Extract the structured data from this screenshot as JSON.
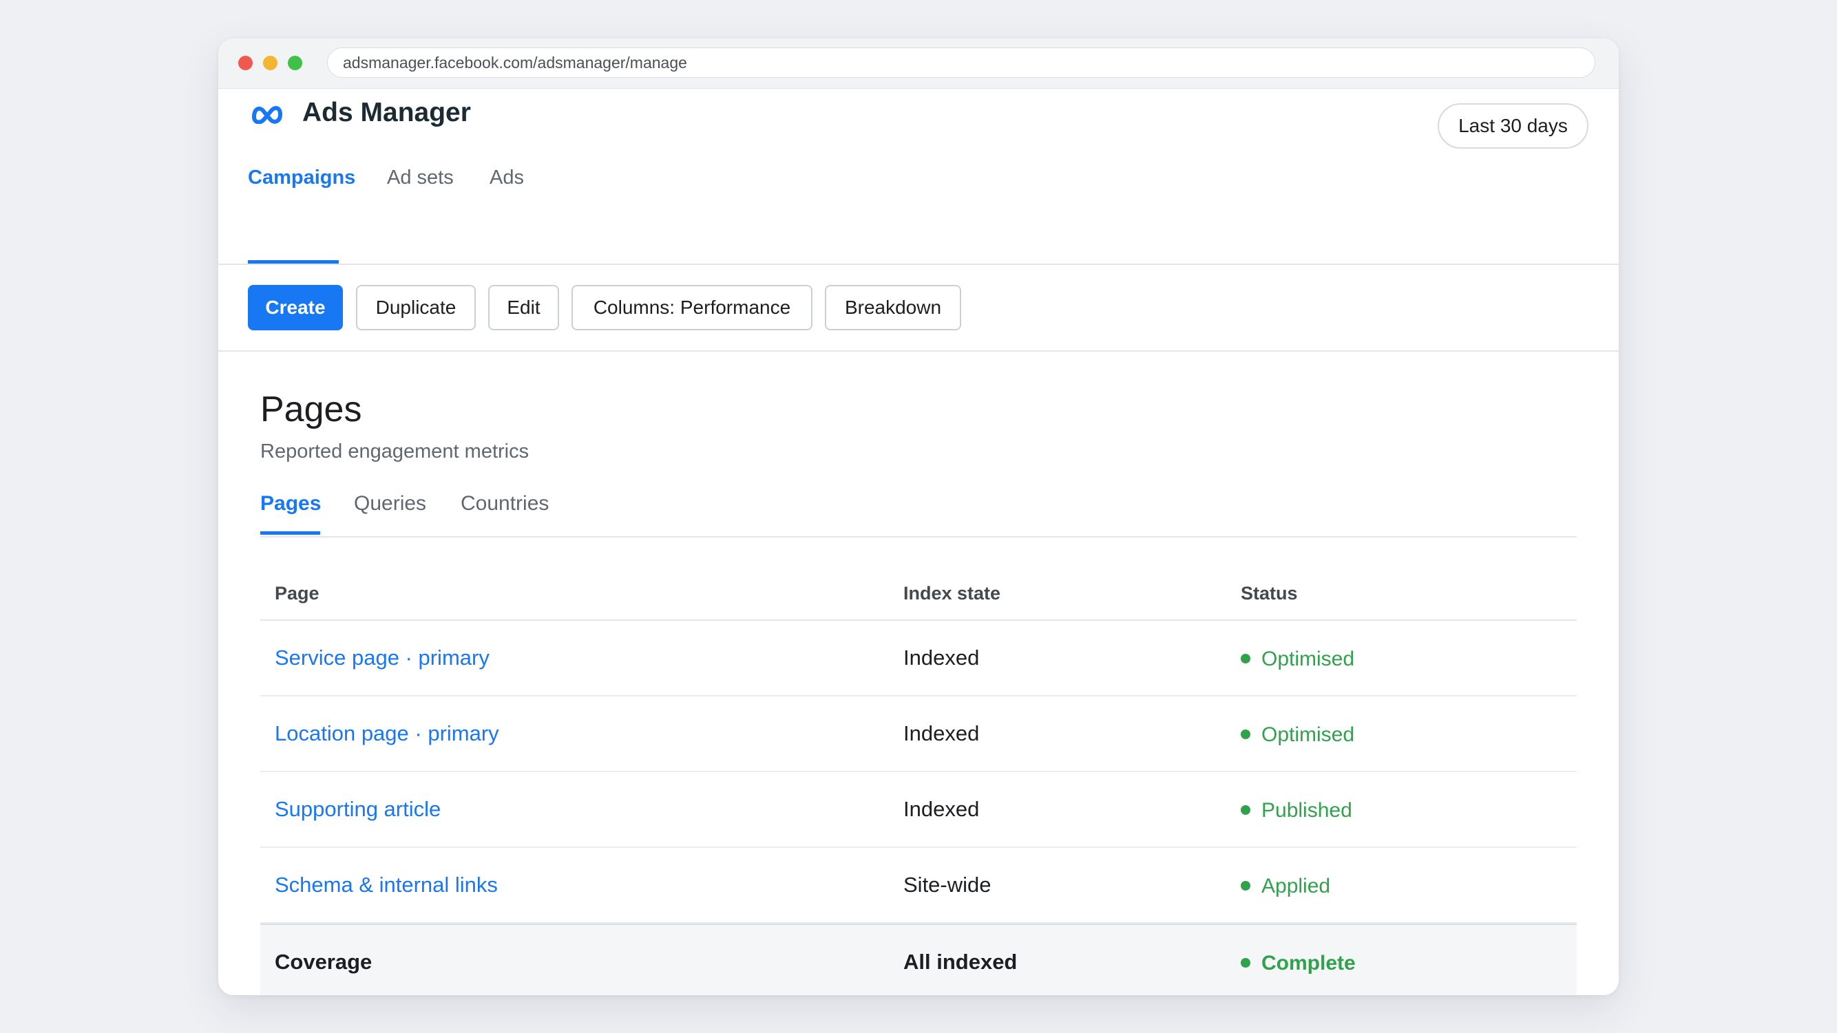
{
  "browser": {
    "url": "adsmanager.facebook.com/adsmanager/manage"
  },
  "app": {
    "title": "Ads Manager",
    "date_range": "Last 30 days"
  },
  "nav_tabs": [
    {
      "label": "Campaigns",
      "active": true
    },
    {
      "label": "Ad sets",
      "active": false
    },
    {
      "label": "Ads",
      "active": false
    }
  ],
  "toolbar": {
    "create": "Create",
    "duplicate": "Duplicate",
    "edit": "Edit",
    "columns": "Columns: Performance",
    "breakdown": "Breakdown"
  },
  "section": {
    "title": "Pages",
    "subtitle": "Reported engagement metrics",
    "tabs": [
      {
        "label": "Pages",
        "active": true
      },
      {
        "label": "Queries",
        "active": false
      },
      {
        "label": "Countries",
        "active": false
      }
    ]
  },
  "table": {
    "headers": [
      "Page",
      "Index state",
      "Status"
    ],
    "rows": [
      {
        "page": "Service page · primary",
        "index_state": "Indexed",
        "status": "Optimised"
      },
      {
        "page": "Location page · primary",
        "index_state": "Indexed",
        "status": "Optimised"
      },
      {
        "page": "Supporting article",
        "index_state": "Indexed",
        "status": "Published"
      },
      {
        "page": "Schema & internal links",
        "index_state": "Site-wide",
        "status": "Applied"
      }
    ],
    "total": {
      "page": "Coverage",
      "index_state": "All indexed",
      "status": "Complete"
    }
  },
  "colors": {
    "accent": "#1877f2",
    "status_green": "#31a24c"
  }
}
